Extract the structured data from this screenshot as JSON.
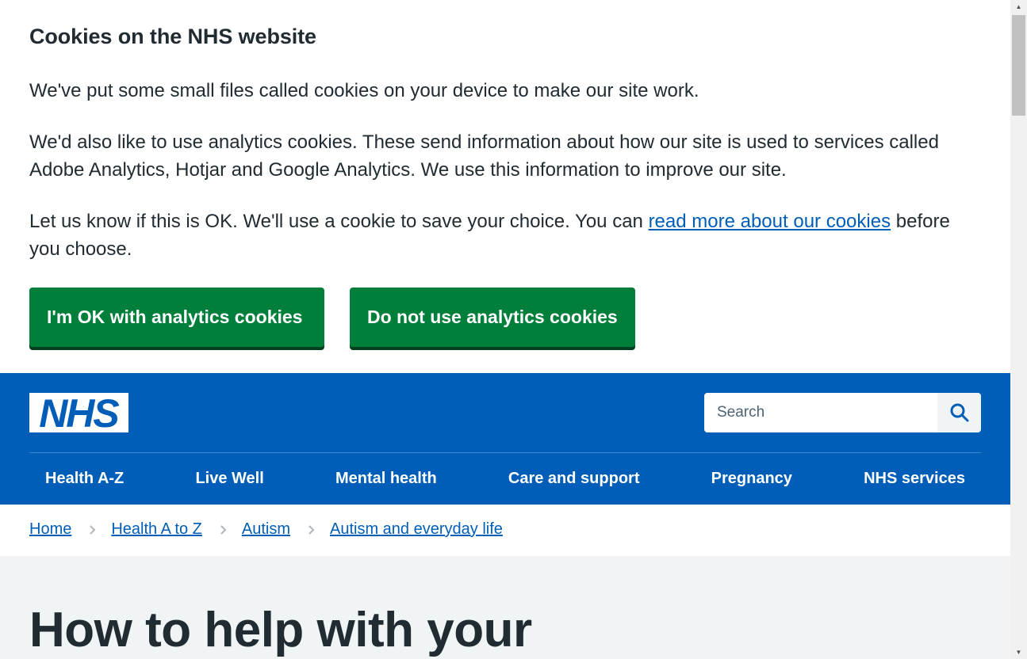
{
  "cookie_banner": {
    "heading": "Cookies on the NHS website",
    "paragraph1": "We've put some small files called cookies on your device to make our site work.",
    "paragraph2": "We'd also like to use analytics cookies. These send information about how our site is used to services called Adobe Analytics, Hotjar and Google Analytics. We use this information to improve our site.",
    "paragraph3_before": "Let us know if this is OK. We'll use a cookie to save your choice. You can ",
    "paragraph3_link": "read more about our cookies",
    "paragraph3_after": " before you choose.",
    "accept_label": "I'm OK with analytics cookies",
    "reject_label": "Do not use analytics cookies"
  },
  "header": {
    "logo_text": "NHS",
    "search_placeholder": "Search",
    "nav": [
      "Health A-Z",
      "Live Well",
      "Mental health",
      "Care and support",
      "Pregnancy",
      "NHS services"
    ]
  },
  "breadcrumb": [
    "Home",
    "Health A to Z",
    "Autism",
    "Autism and everyday life"
  ],
  "page": {
    "title": "How to help with your"
  },
  "colors": {
    "nhs_blue": "#005eb8",
    "button_green": "#007f3b",
    "text": "#212b32",
    "page_bg": "#f0f4f5"
  },
  "icons": {
    "search": "search-icon",
    "breadcrumb_separator": "chevron-right-icon"
  }
}
